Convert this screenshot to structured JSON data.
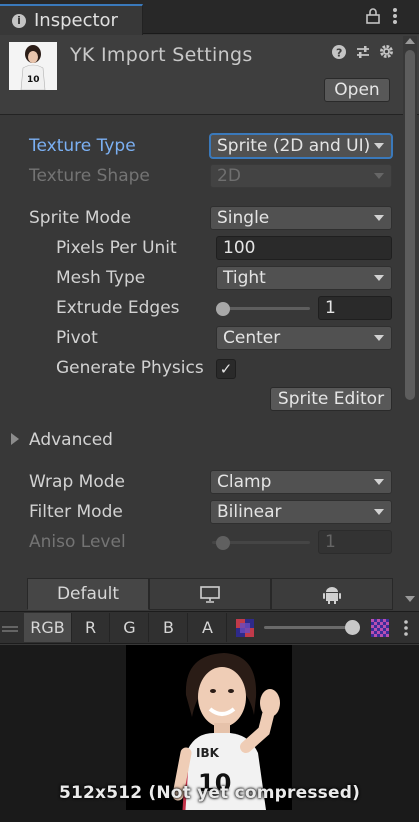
{
  "tab": {
    "title": "Inspector"
  },
  "header": {
    "title": "YK Import Settings",
    "open_label": "Open"
  },
  "fields": {
    "texture_type": {
      "label": "Texture Type",
      "value": "Sprite (2D and UI)"
    },
    "texture_shape": {
      "label": "Texture Shape",
      "value": "2D"
    },
    "sprite_mode": {
      "label": "Sprite Mode",
      "value": "Single"
    },
    "pixels_per_unit": {
      "label": "Pixels Per Unit",
      "value": "100"
    },
    "mesh_type": {
      "label": "Mesh Type",
      "value": "Tight"
    },
    "extrude_edges": {
      "label": "Extrude Edges",
      "value": "1",
      "slider_fraction": 0.05
    },
    "pivot": {
      "label": "Pivot",
      "value": "Center"
    },
    "generate_physics": {
      "label": "Generate Physics",
      "checked": "✓"
    },
    "sprite_editor": {
      "label": "Sprite Editor"
    },
    "advanced": {
      "label": "Advanced"
    },
    "wrap_mode": {
      "label": "Wrap Mode",
      "value": "Clamp"
    },
    "filter_mode": {
      "label": "Filter Mode",
      "value": "Bilinear"
    },
    "aniso_level": {
      "label": "Aniso Level",
      "value": "1",
      "slider_fraction": 0.0
    }
  },
  "platform_tabs": {
    "default": "Default",
    "standalone_icon": "monitor-icon",
    "android_icon": "android-icon"
  },
  "preview": {
    "channels": [
      "RGB",
      "R",
      "G",
      "B",
      "A"
    ],
    "caption": "512x512 (Not yet compressed)",
    "mip_slider_fraction": 1.0
  },
  "colors": {
    "accent": "#3a79bb",
    "label_blue": "#7bb0f3",
    "background": "#383838"
  }
}
